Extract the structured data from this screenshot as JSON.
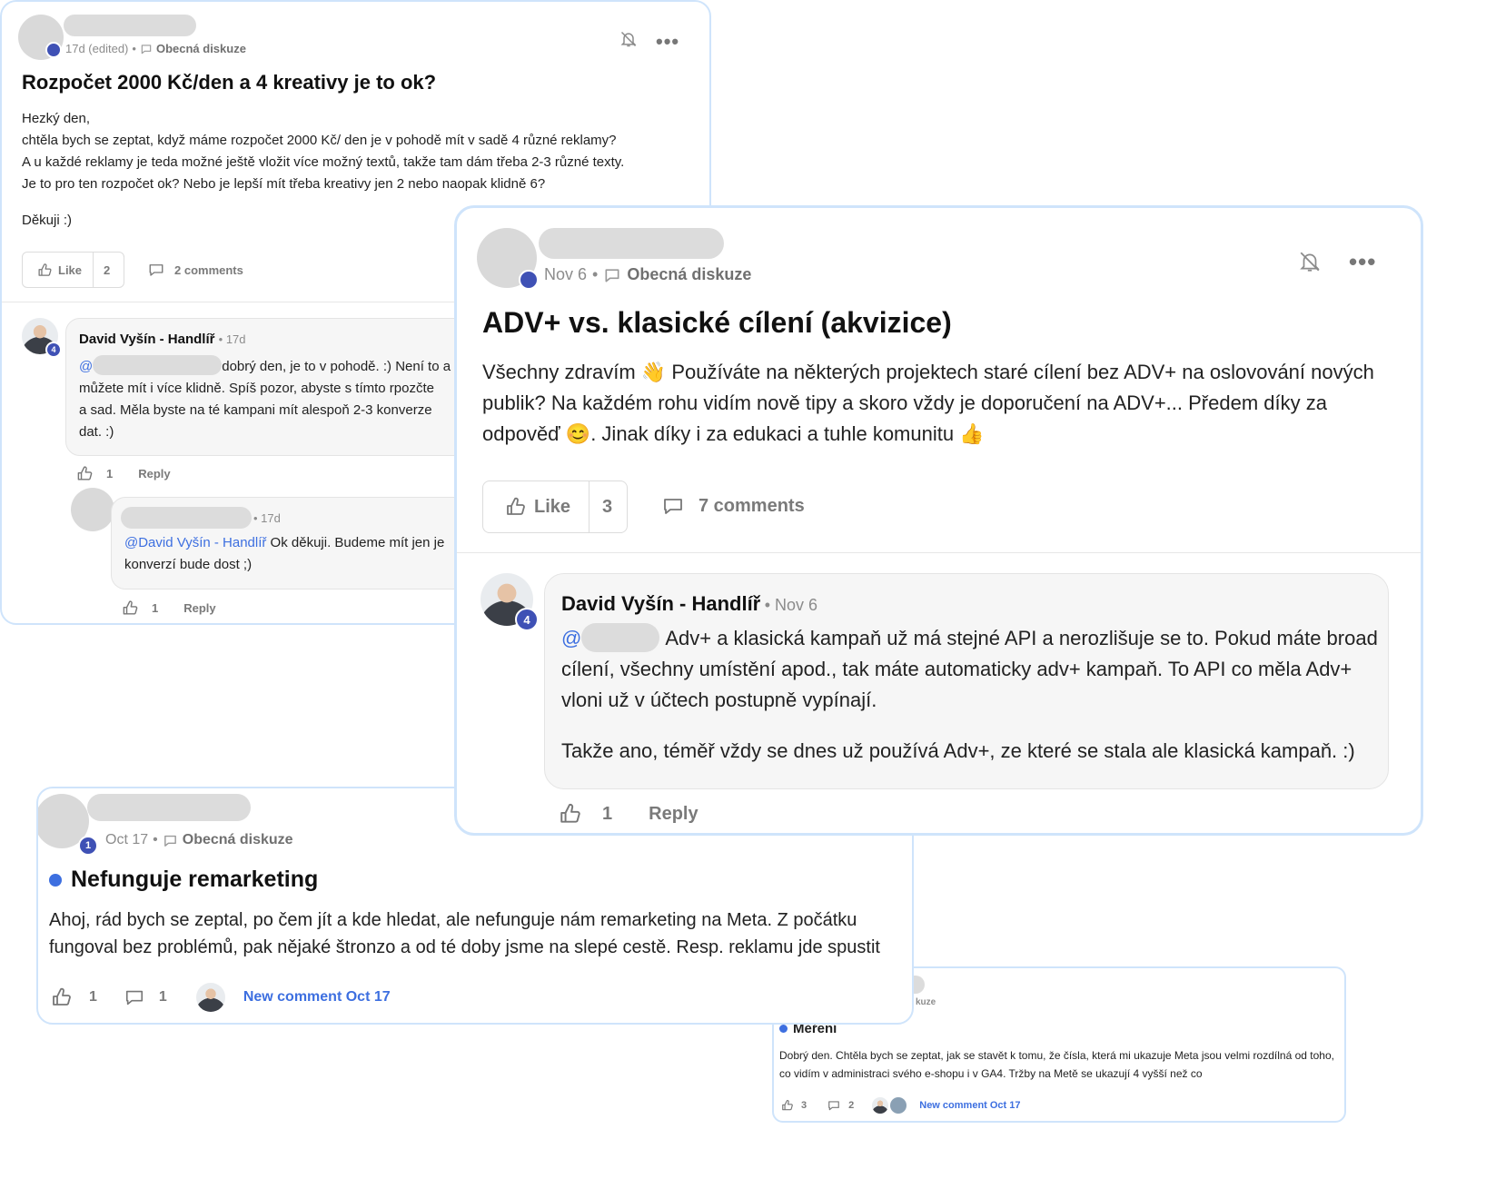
{
  "post1": {
    "meta_time": "17d (edited)",
    "meta_sep": "•",
    "category": "Obecná diskuze",
    "title": "Rozpočet 2000 Kč/den a 4 kreativy je to ok?",
    "body": [
      "Hezký den,",
      "chtěla bych se zeptat, když máme rozpočet 2000 Kč/ den je v pohodě mít v sadě 4 různé reklamy?",
      "A u každé reklamy je teda možné ještě vložit více možný textů, takže tam dám třeba 2-3 různé texty.",
      "Je to pro ten rozpočet ok? Nebo je lepší mít třeba kreativy jen 2 nebo naopak klidně 6?"
    ],
    "thanks": "Děkuji :)",
    "like_label": "Like",
    "like_count": "2",
    "comments_label": "2 comments",
    "comment1": {
      "author": "David Vyšín - Handlíř",
      "time": "• 17d",
      "level": "4",
      "mention": "@",
      "text_line1": "dobrý den, je to v pohodě. :) Není to a",
      "text_line2": "můžete mít i více klidně. Spíš pozor, abyste s tímto rpozčte",
      "text_line3": "a sad. Měla byste na té kampani mít alespoň 2-3 konverze",
      "text_line4": "dat. :)",
      "likes": "1",
      "reply": "Reply"
    },
    "comment2": {
      "time": "• 17d",
      "mention": "@David Vyšín - Handlíř",
      "text_line1": " Ok děkuji. Budeme mít jen je",
      "text_line2": "konverzí bude dost ;)",
      "likes": "1",
      "reply": "Reply"
    }
  },
  "post2": {
    "meta_time": "Nov 6",
    "meta_sep": "•",
    "category": "Obecná diskuze",
    "title": "ADV+ vs. klasické cílení (akvizice)",
    "body": "Všechny zdravím 👋 Používáte na některých projektech staré cílení bez ADV+ na oslovování nových publik? Na každém rohu vidím nově tipy a skoro vždy je doporučení na ADV+... Předem díky za odpověď 😊. Jinak díky i za edukaci a tuhle komunitu 👍",
    "like_label": "Like",
    "like_count": "3",
    "comments_label": "7 comments",
    "comment": {
      "author": "David Vyšín - Handlíř",
      "time": "• Nov 6",
      "level": "4",
      "mention": "@",
      "text1": "Adv+ a klasická kampaň už má stejné API a nerozlišuje se to. Pokud máte broad cílení, všechny umístění apod., tak máte automaticky adv+ kampaň. To API co měla Adv+ vloni už v účtech postupně vypínají.",
      "text2": "Takže ano, téměř vždy se dnes už používá Adv+, ze které se stala ale klasická kampaň. :)",
      "likes": "1",
      "reply": "Reply"
    }
  },
  "post3": {
    "level": "1",
    "meta_time": "Oct 17",
    "meta_sep": "•",
    "category": "Obecná diskuze",
    "title": "Nefunguje remarketing",
    "body": "Ahoj, rád bych se zeptal, po čem jít a kde hledat, ale nefunguje nám remarketing na Meta. Z počátku fungoval bez problémů, pak nějaké štronzo a od té doby jsme na slepé cestě. Resp. reklamu jde spustit",
    "likes": "1",
    "comments": "1",
    "new_comment": "New comment Oct 17"
  },
  "post4": {
    "category_partial": "kuze",
    "title": "Měření",
    "body": "Dobrý den. Chtěla bych se zeptat, jak se stavět k tomu, že čísla, která mi ukazuje Meta jsou velmi rozdílná od toho, co vidím v administraci svého e-shopu i v GA4. Tržby na Metě se ukazují 4 vyšší než co",
    "likes": "3",
    "comments": "2",
    "new_comment": "New comment Oct 17"
  },
  "colors": {
    "accent": "#3d6fe0",
    "badge": "#3f51b5",
    "border": "#cfe4fb"
  }
}
